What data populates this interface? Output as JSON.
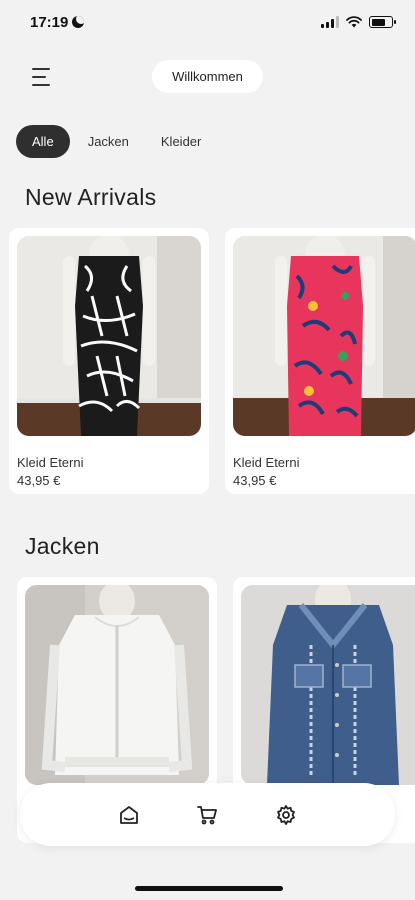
{
  "status_bar": {
    "time": "17:19"
  },
  "header": {
    "welcome_label": "Willkommen"
  },
  "filters": [
    "Alle",
    "Jacken",
    "Kleider"
  ],
  "sections": {
    "new_arrivals": {
      "title": "New Arrivals",
      "products": [
        {
          "name": "Kleid Eterni",
          "price": "43,95 €",
          "image": "black-white-patterned-jumpsuit"
        },
        {
          "name": "Kleid Eterni",
          "price": "43,95 €",
          "image": "pink-floral-dress"
        }
      ]
    },
    "jacken": {
      "title": "Jacken",
      "products": [
        {
          "image": "white-jacket"
        },
        {
          "image": "denim-jacket"
        }
      ]
    }
  },
  "bottom_nav": [
    "home-icon",
    "cart-icon",
    "settings-icon"
  ]
}
